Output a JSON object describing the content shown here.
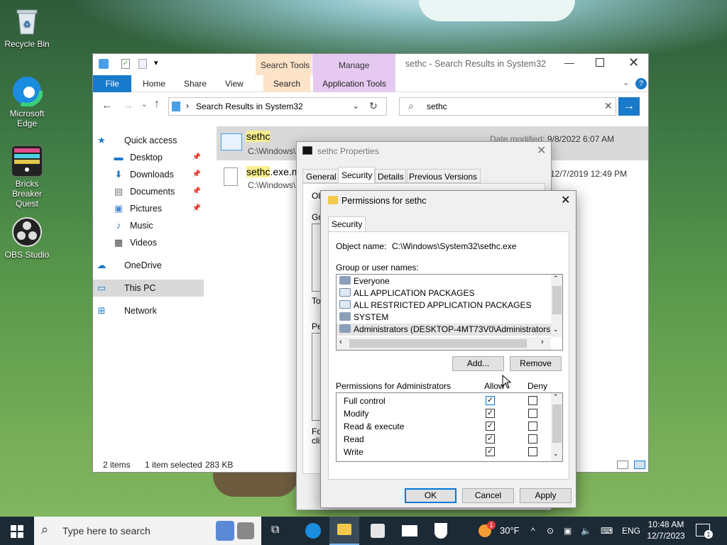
{
  "desktop": {
    "icons": [
      {
        "label": "Recycle Bin"
      },
      {
        "label": "Microsoft Edge"
      },
      {
        "label": "Bricks Breaker Quest"
      },
      {
        "label": "OBS Studio"
      }
    ]
  },
  "explorer": {
    "title": "sethc - Search Results in System32",
    "context_tabs": {
      "search_tools": "Search Tools",
      "manage": "Manage"
    },
    "tabs": [
      "File",
      "Home",
      "Share",
      "View",
      "Search",
      "Application Tools"
    ],
    "address": "Search Results in System32",
    "search_value": "sethc",
    "nav": {
      "quick_access": "Quick access",
      "items": [
        "Desktop",
        "Downloads",
        "Documents",
        "Pictures",
        "Music",
        "Videos"
      ],
      "onedrive": "OneDrive",
      "this_pc": "This PC",
      "network": "Network"
    },
    "results": [
      {
        "name_hl": "sethc",
        "name_rest": "",
        "path": "C:\\Windows\\",
        "meta_label": "Date modified:",
        "meta_value": "9/8/2022 6:07 AM"
      },
      {
        "name_hl": "sethc",
        "name_rest": ".exe.m",
        "path": "C:\\Windows\\",
        "meta_label": "",
        "meta_value": "12/7/2019 12:49 PM"
      }
    ],
    "status": {
      "count": "2 items",
      "selected": "1 item selected",
      "size": "283 KB"
    }
  },
  "props": {
    "title": "sethc Properties",
    "tabs": [
      "General",
      "Security",
      "Details",
      "Previous Versions"
    ],
    "partial": {
      "ob": "Ob",
      "gro": "Gro",
      "to": "To",
      "pe": "Pe",
      "fo": "Fo",
      "cli": "clic"
    }
  },
  "perm": {
    "title": "Permissions for sethc",
    "tab": "Security",
    "object_label": "Object name:",
    "object_value": "C:\\Windows\\System32\\sethc.exe",
    "group_label": "Group or user names:",
    "users": [
      "Everyone",
      "ALL APPLICATION PACKAGES",
      "ALL RESTRICTED APPLICATION PACKAGES",
      "SYSTEM",
      "Administrators (DESKTOP-4MT73V0\\Administrators)"
    ],
    "add": "Add...",
    "remove": "Remove",
    "perm_label": "Permissions for Administrators",
    "allow": "Allow",
    "deny": "Deny",
    "permissions": [
      {
        "name": "Full control",
        "allow": true,
        "deny": false
      },
      {
        "name": "Modify",
        "allow": true,
        "deny": false
      },
      {
        "name": "Read & execute",
        "allow": true,
        "deny": false
      },
      {
        "name": "Read",
        "allow": true,
        "deny": false
      },
      {
        "name": "Write",
        "allow": true,
        "deny": false
      }
    ],
    "ok": "OK",
    "cancel": "Cancel",
    "apply": "Apply"
  },
  "taskbar": {
    "search_placeholder": "Type here to search",
    "weather": "30°F",
    "lang": "ENG",
    "time": "10:48 AM",
    "date": "12/7/2023",
    "notif_count": "1",
    "weather_badge": "1"
  },
  "colors": {
    "accent": "#1979ca",
    "search_tools": "#fde3c8",
    "manage": "#e6c9f0",
    "highlight": "#f9ef8f",
    "taskbar": "#1c2a36"
  }
}
